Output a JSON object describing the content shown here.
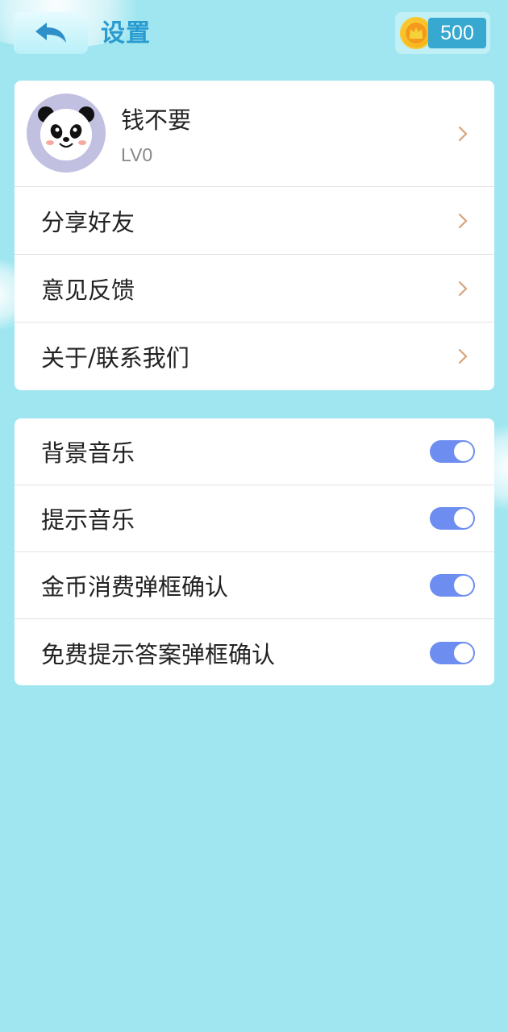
{
  "header": {
    "title": "设置",
    "coins": "500"
  },
  "profile": {
    "nickname": "钱不要",
    "level": "LV0"
  },
  "menu": [
    {
      "label": "分享好友",
      "name": "share-friends"
    },
    {
      "label": "意见反馈",
      "name": "feedback"
    },
    {
      "label": "关于/联系我们",
      "name": "about-contact"
    }
  ],
  "toggles": [
    {
      "label": "背景音乐",
      "name": "background-music",
      "on": true
    },
    {
      "label": "提示音乐",
      "name": "hint-music",
      "on": true
    },
    {
      "label": "金币消费弹框确认",
      "name": "coin-spend-confirm",
      "on": true
    },
    {
      "label": "免费提示答案弹框确认",
      "name": "free-hint-confirm",
      "on": true
    }
  ],
  "icons": {
    "back": "back-arrow-icon",
    "coin": "crown-coin-icon",
    "chevron": "chevron-right-icon",
    "avatar": "panda-avatar"
  },
  "colors": {
    "background": "#9fe6f0",
    "title": "#2a9bd0",
    "coin_badge": "#37a8cf",
    "toggle_on": "#6e8df0",
    "chevron": "#d9a27a"
  }
}
